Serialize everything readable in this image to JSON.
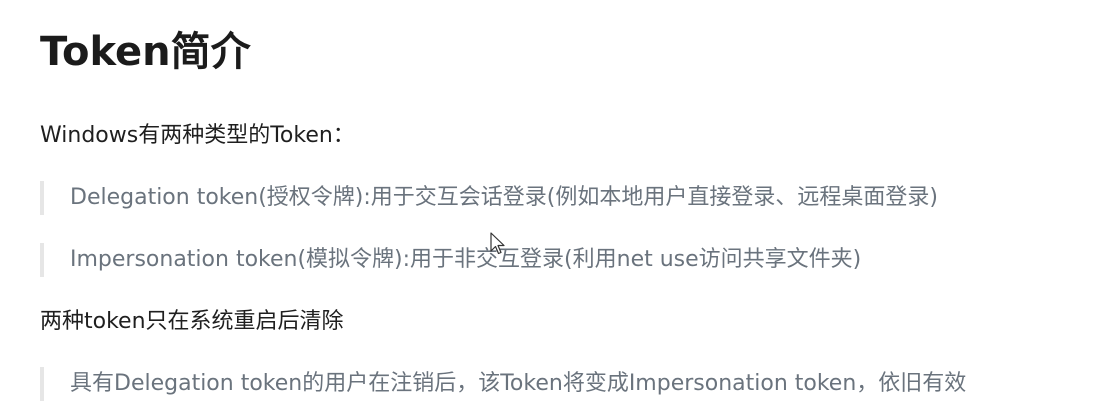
{
  "heading": "Token简介",
  "intro": "Windows有两种类型的Token：",
  "token_types": [
    "Delegation token(授权令牌):用于交互会话登录(例如本地用户直接登录、远程桌面登录)",
    "Impersonation token(模拟令牌):用于非交互登录(利用net use访问共享文件夹)"
  ],
  "clear_note": "两种token只在系统重启后清除",
  "logout_note": "具有Delegation token的用户在注销后，该Token将变成Impersonation token，依旧有效",
  "icons": {
    "cursor": "mouse-pointer-icon"
  }
}
